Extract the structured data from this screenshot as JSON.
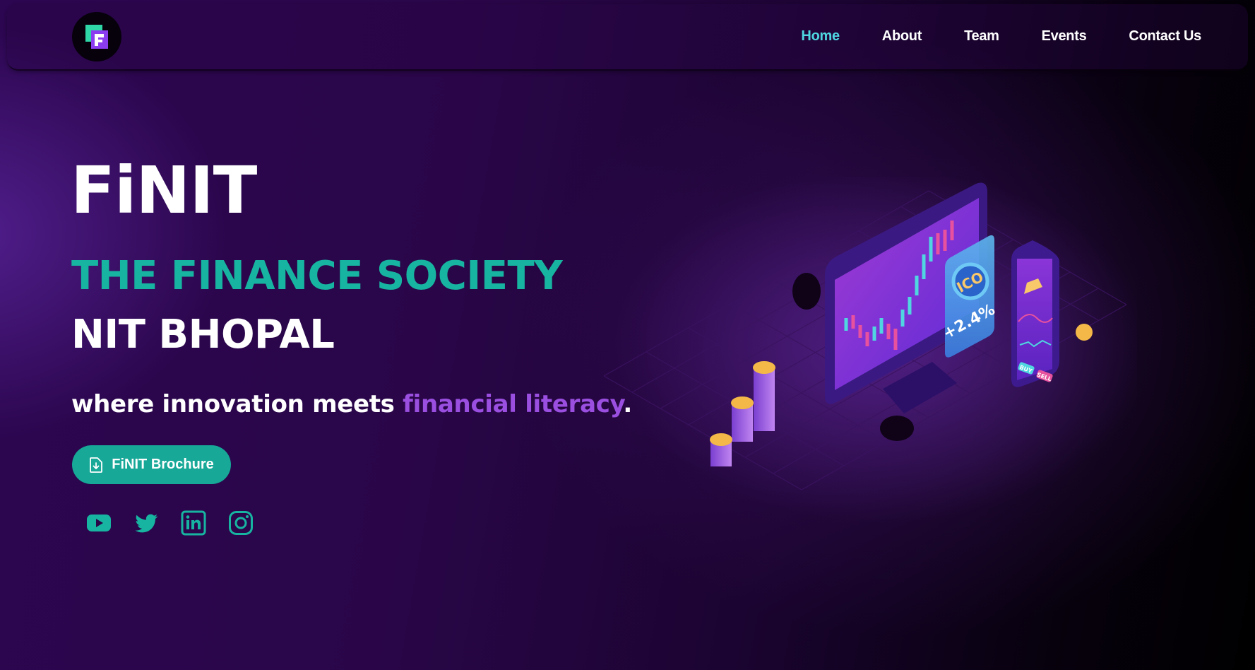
{
  "nav": {
    "logo_letter": "F",
    "links": [
      {
        "label": "Home",
        "active": true
      },
      {
        "label": "About",
        "active": false
      },
      {
        "label": "Team",
        "active": false
      },
      {
        "label": "Events",
        "active": false
      },
      {
        "label": "Contact Us",
        "active": false
      }
    ]
  },
  "hero": {
    "title": "FiNIT",
    "subtitle_1": "THE FINANCE SOCIETY",
    "subtitle_2": "NIT BHOPAL",
    "tagline_start": "where innovation meets ",
    "tagline_accent": "financial literacy",
    "tagline_end": ".",
    "brochure_label": "FiNIT Brochure"
  },
  "socials": [
    {
      "icon": "youtube-icon"
    },
    {
      "icon": "twitter-icon"
    },
    {
      "icon": "linkedin-icon"
    },
    {
      "icon": "instagram-icon"
    }
  ],
  "illustration": {
    "ico_label": "ICO",
    "ico_change": "+2.4%",
    "buy_label": "BUY",
    "sell_label": "SELL"
  },
  "colors": {
    "accent_teal": "#17b5a1",
    "nav_active": "#4fd6e0",
    "accent_purple": "#9a4fe0",
    "background": "#2a0649"
  }
}
